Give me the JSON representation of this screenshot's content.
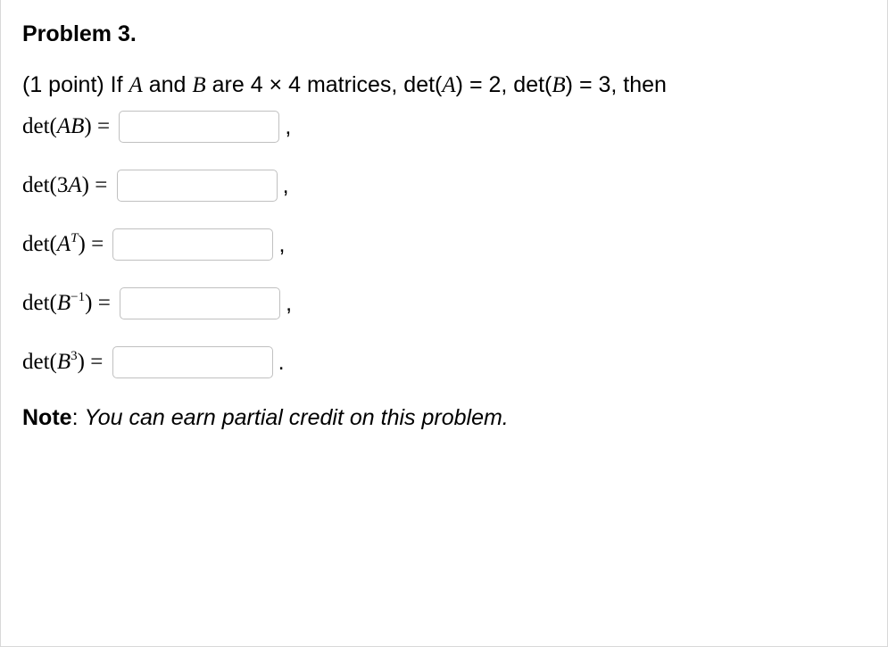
{
  "title": "Problem 3.",
  "prompt": {
    "points_prefix": "(1 point) If ",
    "matA": "A",
    "and": " and ",
    "matB": "B",
    "are": " are 4 × 4 matrices, ",
    "detA_eq": "det(",
    "detA_var": "A",
    "detA_close": ") = 2, ",
    "detB_eq": "det(",
    "detB_var": "B",
    "detB_close": ") = 3, then"
  },
  "rows": {
    "r1": {
      "det": "det(",
      "var": "AB",
      "close": ") = ",
      "trail": ","
    },
    "r2": {
      "det": "det(3",
      "var": "A",
      "close": ") = ",
      "trail": ","
    },
    "r3": {
      "det": "det(",
      "var": "A",
      "sup": "T",
      "close": ") = ",
      "trail": ","
    },
    "r4": {
      "det": "det(",
      "var": "B",
      "sup": "−1",
      "close": ") = ",
      "trail": ","
    },
    "r5": {
      "det": "det(",
      "var": "B",
      "sup": "3",
      "close": ") = ",
      "trail": "."
    }
  },
  "note": {
    "label": "Note",
    "colon": ": ",
    "text": "You can earn partial credit on this problem."
  }
}
